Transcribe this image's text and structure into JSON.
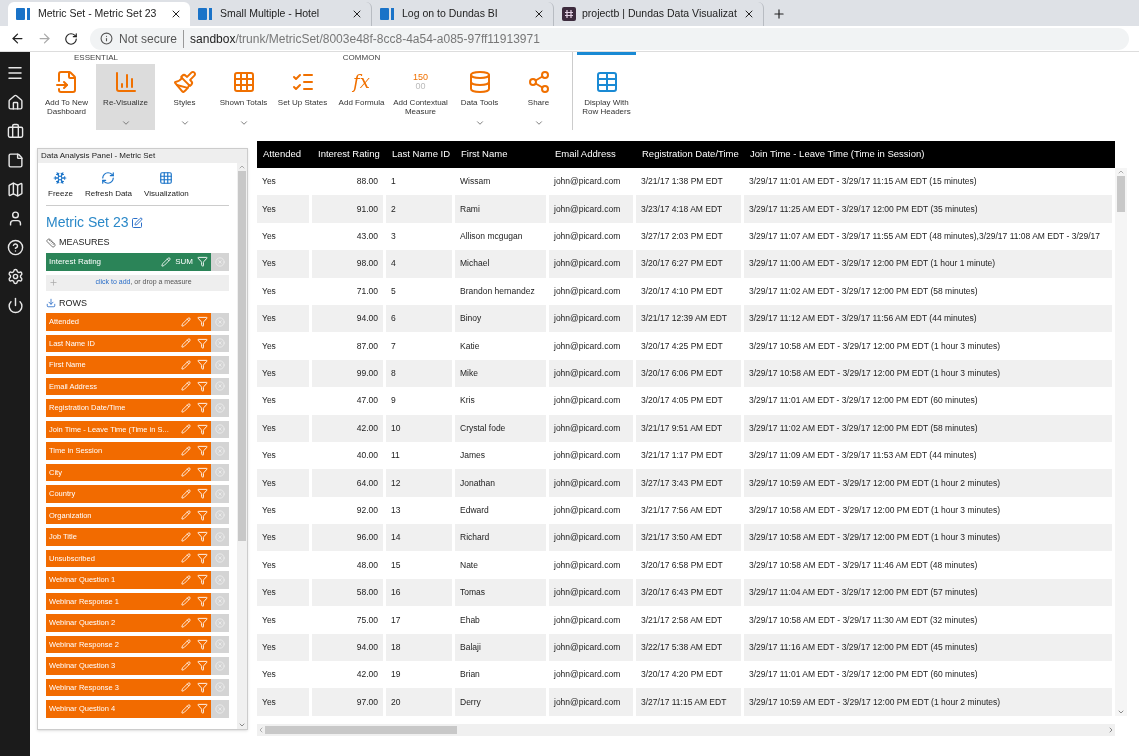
{
  "browser": {
    "tabs": [
      {
        "title": "Metric Set - Metric Set 23",
        "selected": true,
        "kind": "bi"
      },
      {
        "title": "Small Multiple - Hotel",
        "selected": false,
        "kind": "bi"
      },
      {
        "title": "Log on to Dundas BI",
        "selected": false,
        "kind": "bi"
      },
      {
        "title": "projectb | Dundas Data Visualizat",
        "selected": false,
        "kind": "hash"
      }
    ],
    "security": "Not secure",
    "url_host": "sandbox",
    "url_path": "/trunk/MetricSet/8003e48f-8cc8-4a54-a085-97ff11913971"
  },
  "toolbar": {
    "sections": [
      {
        "label": "ESSENTIAL",
        "items": [
          {
            "label": "Add To New Dashboard",
            "selected": false,
            "has_menu": false
          },
          {
            "label": "Re-Visualize",
            "selected": true,
            "has_menu": true
          }
        ]
      },
      {
        "label": "COMMON",
        "items": [
          {
            "label": "Styles",
            "selected": false,
            "has_menu": true
          },
          {
            "label": "Shown Totals",
            "selected": false,
            "has_menu": true
          },
          {
            "label": "Set Up States",
            "selected": false,
            "has_menu": false
          },
          {
            "label": "Add Formula",
            "selected": false,
            "has_menu": false,
            "icon_text": [
              "fx"
            ]
          },
          {
            "label": "Add Contextual Measure",
            "selected": false,
            "has_menu": false,
            "icon_text": [
              "150",
              "00"
            ]
          },
          {
            "label": "Data Tools",
            "selected": false,
            "has_menu": true
          },
          {
            "label": "Share",
            "selected": false,
            "has_menu": true
          }
        ]
      },
      {
        "accent": true,
        "items": [
          {
            "label": "Display With Row Headers",
            "selected": false,
            "has_menu": false
          }
        ]
      }
    ]
  },
  "panel": {
    "title": "Data Analysis Panel - Metric Set",
    "tools": [
      "Freeze",
      "Refresh Data",
      "Visualization"
    ],
    "metric_set": "Metric Set 23",
    "measures_label": "MEASURES",
    "measures": [
      {
        "name": "Interest Rating",
        "aggregate": "SUM"
      }
    ],
    "add_link": "click to add",
    "add_hint": ", or drop a measure",
    "rows_label": "ROWS",
    "rows": [
      "Attended",
      "Last Name ID",
      "First Name",
      "Email Address",
      "Registration Date/Time",
      "Join Time - Leave Time (Time in S...",
      "Time in Session",
      "City",
      "Country",
      "Organization",
      "Job Title",
      "Unsubscribed",
      "Webinar Question 1",
      "Webinar Response 1",
      "Webinar Question 2",
      "Webinar Response 2",
      "Webinar Question 3",
      "Webinar Response 3",
      "Webinar Question 4"
    ]
  },
  "table": {
    "columns": [
      "Attended",
      "Interest Rating",
      "Last Name ID",
      "First Name",
      "Email Address",
      "Registration Date/Time",
      "Join Time - Leave Time (Time in Session)"
    ],
    "rows": [
      [
        "Yes",
        "88.00",
        "1",
        "Wissam",
        "john@picard.com",
        "3/21/17 1:38 PM EDT",
        "3/29/17 11:01 AM EDT - 3/29/17 11:15 AM EDT (15 minutes)"
      ],
      [
        "Yes",
        "91.00",
        "2",
        "Rami",
        "john@picard.com",
        "3/23/17 4:18 AM EDT",
        "3/29/17 11:25 AM EDT - 3/29/17 12:00 PM EDT (35 minutes)"
      ],
      [
        "Yes",
        "43.00",
        "3",
        "Allison mcgugan",
        "john@picard.com",
        "3/27/17 2:03 PM EDT",
        "3/29/17 11:07 AM EDT - 3/29/17 11:55 AM EDT (48 minutes),3/29/17 11:08 AM EDT - 3/29/17"
      ],
      [
        "Yes",
        "98.00",
        "4",
        "Michael",
        "john@picard.com",
        "3/20/17 6:27 PM EDT",
        "3/29/17 11:00 AM EDT - 3/29/17 12:00 PM EDT (1 hour 1 minute)"
      ],
      [
        "Yes",
        "71.00",
        "5",
        "Brandon hernandez",
        "john@picard.com",
        "3/20/17 4:10 PM EDT",
        "3/29/17 11:02 AM EDT - 3/29/17 12:00 PM EDT (58 minutes)"
      ],
      [
        "Yes",
        "94.00",
        "6",
        "Binoy",
        "john@picard.com",
        "3/21/17 12:39 AM EDT",
        "3/29/17 11:12 AM EDT - 3/29/17 11:56 AM EDT (44 minutes)"
      ],
      [
        "Yes",
        "87.00",
        "7",
        "Katie",
        "john@picard.com",
        "3/20/17 4:25 PM EDT",
        "3/29/17 10:58 AM EDT - 3/29/17 12:00 PM EDT (1 hour 3 minutes)"
      ],
      [
        "Yes",
        "99.00",
        "8",
        "Mike",
        "john@picard.com",
        "3/20/17 6:06 PM EDT",
        "3/29/17 10:58 AM EDT - 3/29/17 12:00 PM EDT (1 hour 3 minutes)"
      ],
      [
        "Yes",
        "47.00",
        "9",
        "Kris",
        "john@picard.com",
        "3/20/17 4:05 PM EDT",
        "3/29/17 11:01 AM EDT - 3/29/17 12:00 PM EDT (60 minutes)"
      ],
      [
        "Yes",
        "42.00",
        "10",
        "Crystal fode",
        "john@picard.com",
        "3/21/17 9:51 AM EDT",
        "3/29/17 11:02 AM EDT - 3/29/17 12:00 PM EDT (58 minutes)"
      ],
      [
        "Yes",
        "40.00",
        "11",
        "James",
        "john@picard.com",
        "3/21/17 1:17 PM EDT",
        "3/29/17 11:09 AM EDT - 3/29/17 11:53 AM EDT (44 minutes)"
      ],
      [
        "Yes",
        "64.00",
        "12",
        "Jonathan",
        "john@picard.com",
        "3/27/17 3:43 PM EDT",
        "3/29/17 10:59 AM EDT - 3/29/17 12:00 PM EDT (1 hour 2 minutes)"
      ],
      [
        "Yes",
        "92.00",
        "13",
        "Edward",
        "john@picard.com",
        "3/21/17 7:56 AM EDT",
        "3/29/17 10:58 AM EDT - 3/29/17 12:00 PM EDT (1 hour 3 minutes)"
      ],
      [
        "Yes",
        "96.00",
        "14",
        "Richard",
        "john@picard.com",
        "3/21/17 3:50 AM EDT",
        "3/29/17 10:58 AM EDT - 3/29/17 12:00 PM EDT (1 hour 3 minutes)"
      ],
      [
        "Yes",
        "48.00",
        "15",
        "Nate",
        "john@picard.com",
        "3/20/17 6:58 PM EDT",
        "3/29/17 10:58 AM EDT - 3/29/17 11:46 AM EDT (48 minutes)"
      ],
      [
        "Yes",
        "58.00",
        "16",
        "Tomas",
        "john@picard.com",
        "3/20/17 6:43 PM EDT",
        "3/29/17 11:04 AM EDT - 3/29/17 12:00 PM EDT (57 minutes)"
      ],
      [
        "Yes",
        "75.00",
        "17",
        "Ehab",
        "john@picard.com",
        "3/21/17 2:58 AM EDT",
        "3/29/17 10:58 AM EDT - 3/29/17 11:30 AM EDT (32 minutes)"
      ],
      [
        "Yes",
        "94.00",
        "18",
        "Balaji",
        "john@picard.com",
        "3/22/17 5:38 AM EDT",
        "3/29/17 11:16 AM EDT - 3/29/17 12:00 PM EDT (45 minutes)"
      ],
      [
        "Yes",
        "42.00",
        "19",
        "Brian",
        "john@picard.com",
        "3/20/17 4:20 PM EDT",
        "3/29/17 11:01 AM EDT - 3/29/17 12:00 PM EDT (60 minutes)"
      ],
      [
        "Yes",
        "97.00",
        "20",
        "Derry",
        "john@picard.com",
        "3/27/17 11:15 AM EDT",
        "3/29/17 10:59 AM EDT - 3/29/17 12:00 PM EDT (1 hour 2 minutes)"
      ]
    ]
  }
}
